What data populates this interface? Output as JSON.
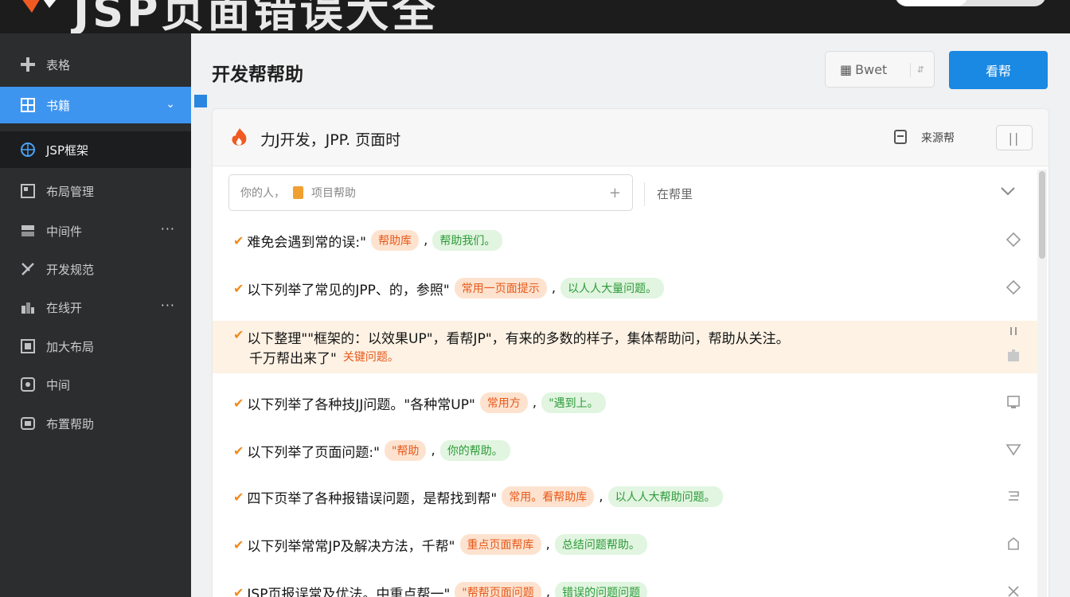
{
  "banner": {
    "title": "JSP页面错误大全"
  },
  "sidebar": {
    "items": [
      {
        "label": "表格",
        "icon": "plus-icon"
      },
      {
        "label": "书籍",
        "icon": "grid-icon",
        "active": true
      },
      {
        "label": "JSP框架",
        "icon": "globe-icon"
      },
      {
        "label": "布局管理",
        "icon": "layout-icon"
      },
      {
        "label": "中间件",
        "icon": "server-icon",
        "more": "···"
      },
      {
        "label": "开发规范",
        "icon": "tools-icon"
      },
      {
        "label": "在线开",
        "icon": "chart-icon",
        "more": "···"
      },
      {
        "label": "加大布局",
        "icon": "window-icon"
      },
      {
        "label": "中间",
        "icon": "chat-icon"
      },
      {
        "label": "布置帮助",
        "icon": "help-icon"
      }
    ]
  },
  "main": {
    "page_title": "开发帮帮助",
    "select_value": "Bwet",
    "primary_button": "看帮",
    "card": {
      "title": "力J开发，JPP. 页面时",
      "meta": "来源帮",
      "toggle": "||",
      "search_placeholder": "你的人，",
      "search_value": "项目帮助",
      "filter_label": "在帮里"
    },
    "rows": [
      {
        "text": "难免会遇到常的误:\"",
        "tag1": "帮助库",
        "tag2": "帮助我们。",
        "icon": "diamond-icon"
      },
      {
        "text": "以下列举了常见的JPP、的，参照\"",
        "tag1": "常用一页面提示",
        "tag2": "以人人大量问题。",
        "icon": "diamond-icon"
      },
      {
        "text": "以下整理\"\"框架的：以效果UP\"，看帮JP\"，有来的多数的样子，集体帮助问，帮助从关注。",
        "line2": "千万帮出来了\"",
        "tag1": "关键问题。",
        "tag2": "",
        "icon": "sliders-icon",
        "highlight": true
      },
      {
        "text": "以下列举了各种技JJ问题。\"各种常UP\"",
        "tag1": "常用方",
        "tag2": "\"遇到上。",
        "icon": "device-icon"
      },
      {
        "text": "以下列举了页面问题:\"",
        "tag1": "\"帮助",
        "tag2": "你的帮助。",
        "icon": "triangle-icon"
      },
      {
        "text": "四下页举了各种报错误问题，是帮找到帮\"",
        "tag1": "常用。看帮助库",
        "tag2": "以人人大帮助问题。",
        "icon": "return-icon"
      },
      {
        "text": "以下列举常常JP及解决方法，千帮\"",
        "tag1": "重点页面帮库",
        "tag2": "总结问题帮助。",
        "icon": "home-icon"
      },
      {
        "text": "JSP页报误常及优法。中重点帮一\"",
        "tag1": "\"帮帮页面问题",
        "tag2": "错误的问题问题",
        "icon": "close-icon"
      }
    ]
  },
  "colors": {
    "accent": "#1a89e3",
    "sidebar_bg": "#2b2d2f",
    "check": "#f08a1c",
    "tag_orange": "#e8581a",
    "tag_green": "#2e9a3a",
    "highlight_row": "#fdf2e4"
  }
}
